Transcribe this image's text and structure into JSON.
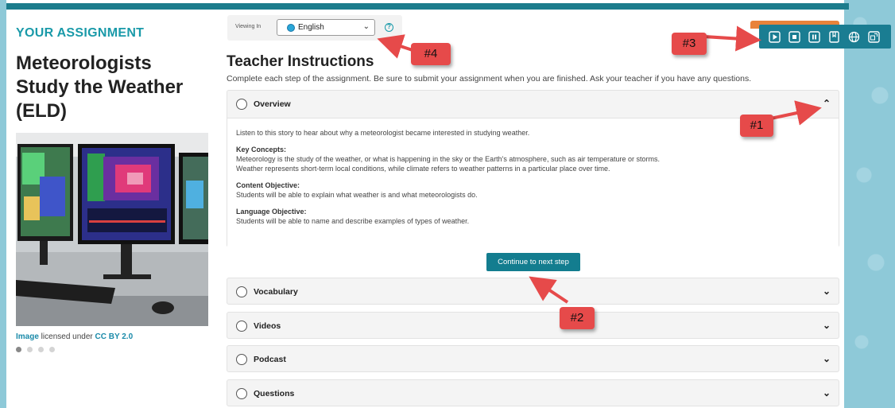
{
  "left": {
    "section_label": "YOUR ASSIGNMENT",
    "title": "Meteorologists Study the Weather (ELD)",
    "credit_link1": "Image",
    "credit_mid": " licensed under ",
    "credit_link2": "CC BY 2.0",
    "carousel_dots": 4
  },
  "viewer": {
    "label": "Viewing In",
    "language": "English",
    "help": "?"
  },
  "instructions": {
    "title": "Teacher Instructions",
    "subtitle": "Complete each step of the assignment. Be sure to submit your assignment when you are finished. Ask your teacher if you have any questions."
  },
  "overview": {
    "label": "Overview",
    "intro": "Listen to this story to hear about why a meteorologist became interested in studying weather.",
    "key_concepts_heading": "Key Concepts:",
    "key_concepts_1": "Meteorology is the study of the weather, or what is happening in the sky or the Earth's atmosphere, such as air temperature or storms.",
    "key_concepts_2": "Weather represents short-term local conditions, while climate refers to weather patterns in a particular place over time.",
    "content_objective_heading": "Content Objective:",
    "content_objective": "Students will be able to explain what weather is and what meteorologists do.",
    "language_objective_heading": "Language Objective:",
    "language_objective": "Students will be able to name and describe examples of types of weather."
  },
  "continue_button": "Continue to next step",
  "steps": [
    {
      "label": "Vocabulary"
    },
    {
      "label": "Videos"
    },
    {
      "label": "Podcast"
    },
    {
      "label": "Questions"
    }
  ],
  "toolbar_icons": [
    "play-icon",
    "stop-icon",
    "pause-icon",
    "bookmark-icon",
    "globe-icon",
    "translate-icon"
  ],
  "callouts": [
    "#1",
    "#2",
    "#3",
    "#4"
  ],
  "colors": {
    "accent": "#1a9aa9",
    "button": "#137d8f",
    "toolbar": "#1a7d92",
    "callout": "#e64a4a",
    "orange": "#e8833a"
  }
}
